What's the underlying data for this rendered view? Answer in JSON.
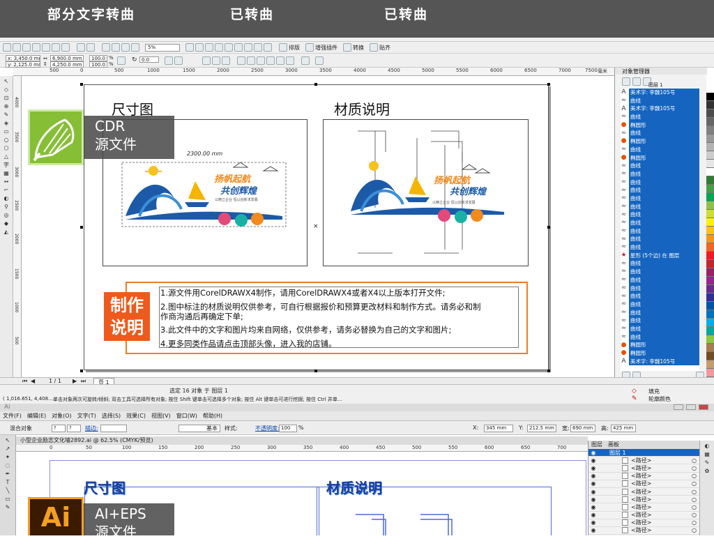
{
  "banner": {
    "left": "部分文字转曲",
    "middle": "已转曲",
    "right": "已转曲"
  },
  "corel": {
    "toolbar": {
      "zoom": "5%",
      "buttons": [
        "排版",
        "增强插件",
        "转换",
        "贴齐"
      ]
    },
    "props": {
      "x": "x: 3,450.0 mm",
      "y": "y: 2,125.0 mm",
      "w": "6,900.0 mm",
      "h": "4,250.0 mm",
      "sx": "100.0",
      "sy": "100.0",
      "pct": "%",
      "angle": "0.0"
    },
    "ruler_top": [
      "500",
      "0",
      "500",
      "1000",
      "1500",
      "2000",
      "2500",
      "3000",
      "3500",
      "4000",
      "4500",
      "5000",
      "5500",
      "6000",
      "6500",
      "7000",
      "7500",
      "毫米"
    ],
    "ruler_left": [
      "4000",
      "3500",
      "3000",
      "2500",
      "2000",
      "1500",
      "1000",
      "500"
    ],
    "badge": {
      "line1": "CDR",
      "line2": "源文件"
    },
    "titles": {
      "size": "尺寸图",
      "material": "材质说明"
    },
    "dimension_label": "2300.00 mm",
    "art": {
      "slogan1": "扬帆起航",
      "slogan2": "共创辉煌",
      "small": "以精立企业 恒以创新求发展"
    },
    "notes": {
      "badge_line1": "制作",
      "badge_line2": "说明",
      "items": [
        "1.源文件用CorelDRAWX4制作，请用CorelDRAWX4或者X4以上版本打开文件;",
        "2.图中标注的材质说明仅供参考，可自行根据报价和预算更改材料和制作方式。请务必和制",
        "作商沟通后再确定下单;",
        "3.此文件中的文字和图片均来自网络，仅供参考，请务必替换为自己的文字和图片;",
        "4.更多同类作品请点击顶部头像，进入我的店铺。"
      ]
    },
    "object_manager": {
      "title": "对象管理器",
      "layer": "图层 1",
      "rows": [
        {
          "icon": "A",
          "text": "美术字: 李魏105号"
        },
        {
          "icon": "≈",
          "text": "曲线"
        },
        {
          "icon": "A",
          "text": "美术字: 李魏105号"
        },
        {
          "icon": "≈",
          "text": "曲线"
        },
        {
          "icon": "●",
          "text": "椭圆形"
        },
        {
          "icon": "≈",
          "text": "曲线"
        },
        {
          "icon": "●",
          "text": "椭圆形"
        },
        {
          "icon": "≈",
          "text": "曲线"
        },
        {
          "icon": "●",
          "text": "椭圆形"
        },
        {
          "icon": "≈",
          "text": "曲线"
        },
        {
          "icon": "≈",
          "text": "曲线"
        },
        {
          "icon": "≈",
          "text": "曲线"
        },
        {
          "icon": "≈",
          "text": "曲线"
        },
        {
          "icon": "≈",
          "text": "曲线"
        },
        {
          "icon": "≈",
          "text": "曲线"
        },
        {
          "icon": "≈",
          "text": "曲线"
        },
        {
          "icon": "≈",
          "text": "曲线"
        },
        {
          "icon": "≈",
          "text": "曲线"
        },
        {
          "icon": "≈",
          "text": "曲线"
        },
        {
          "icon": "≈",
          "text": "曲线"
        },
        {
          "icon": "★",
          "text": "星形 (5个边) 在 图层"
        },
        {
          "icon": "≈",
          "text": "曲线"
        },
        {
          "icon": "≈",
          "text": "曲线"
        },
        {
          "icon": "≈",
          "text": "曲线"
        },
        {
          "icon": "≈",
          "text": "曲线"
        },
        {
          "icon": "≈",
          "text": "曲线"
        },
        {
          "icon": "≈",
          "text": "曲线"
        },
        {
          "icon": "≈",
          "text": "曲线"
        },
        {
          "icon": "≈",
          "text": "曲线"
        },
        {
          "icon": "≈",
          "text": "曲线"
        },
        {
          "icon": "≈",
          "text": "曲线"
        },
        {
          "icon": "●",
          "text": "椭圆形"
        },
        {
          "icon": "●",
          "text": "椭圆形"
        },
        {
          "icon": "A",
          "text": "美术字: 李魏105号"
        }
      ]
    },
    "status": {
      "page_nav": "1 / 1",
      "page_tab": "页 1",
      "selection": "选定 16 对象 于 图层 1",
      "coords": "( 1,016.651, 4,408....",
      "hint": "单击对象两次可旋转/倾斜; 双击工具可选择所有对象; 按住 Shift 键单击可选择多个对象; 按住 Alt 键单击可进行挖掘; 按住 Ctrl 并单...",
      "fill": "填充",
      "outline": "轮廓颜色"
    },
    "palette": [
      "#000000",
      "#333333",
      "#4d4d4d",
      "#666666",
      "#808080",
      "#999999",
      "#b3b3b3",
      "#cccccc",
      "#e6e6e6",
      "#ffffff",
      "#2e7d32",
      "#43a047",
      "#00a651",
      "#8bc34a",
      "#cddc39",
      "#fff200",
      "#ffc20e",
      "#f7941d",
      "#f26522",
      "#ed1c24",
      "#c1272d",
      "#9e1f63",
      "#92278f",
      "#662d91",
      "#2e3192",
      "#0054a6",
      "#0072bc",
      "#00aeef",
      "#00a99d",
      "#8dc63f",
      "#a67c52",
      "#754c24",
      "#c69c6d",
      "#f5989d"
    ]
  },
  "ai": {
    "menu": [
      "文件(F)",
      "编辑(E)",
      "对象(O)",
      "文字(T)",
      "选择(S)",
      "效果(C)",
      "视图(V)",
      "窗口(W)",
      "帮助(H)"
    ],
    "control": {
      "left": "混合对象",
      "stroke_label": "描边:",
      "basic": "基本",
      "style": "样式:",
      "opacity_label": "不透明度:",
      "opacity": "100",
      "pct": "%",
      "x_label": "X:",
      "x": "345 mm",
      "y_label": "Y:",
      "y": "212.5 mm",
      "w_label": "宽:",
      "w": "690 mm",
      "h_label": "高:",
      "h": "425 mm"
    },
    "doc_tab": "小型企业励志文化墙2892.ai @ 62.5% (CMYK/预览)",
    "ruler": [
      "0",
      "50",
      "100",
      "150",
      "200",
      "250",
      "300",
      "350",
      "400",
      "450",
      "500",
      "550",
      "600",
      "650",
      "700"
    ],
    "titles": {
      "size": "尺寸图",
      "material": "材质说明"
    },
    "badge": {
      "logo": "Ai",
      "line1": "AI+EPS",
      "line2": "源文件"
    },
    "layers": {
      "tab1": "图层",
      "tab2": "画板",
      "layer": "图层 1",
      "rows": [
        "<路径>",
        "<路径>",
        "<路径>",
        "<路径>",
        "<路径>",
        "<路径>",
        "<路径>",
        "<路径>",
        "<路径>",
        "<路径>"
      ]
    }
  }
}
